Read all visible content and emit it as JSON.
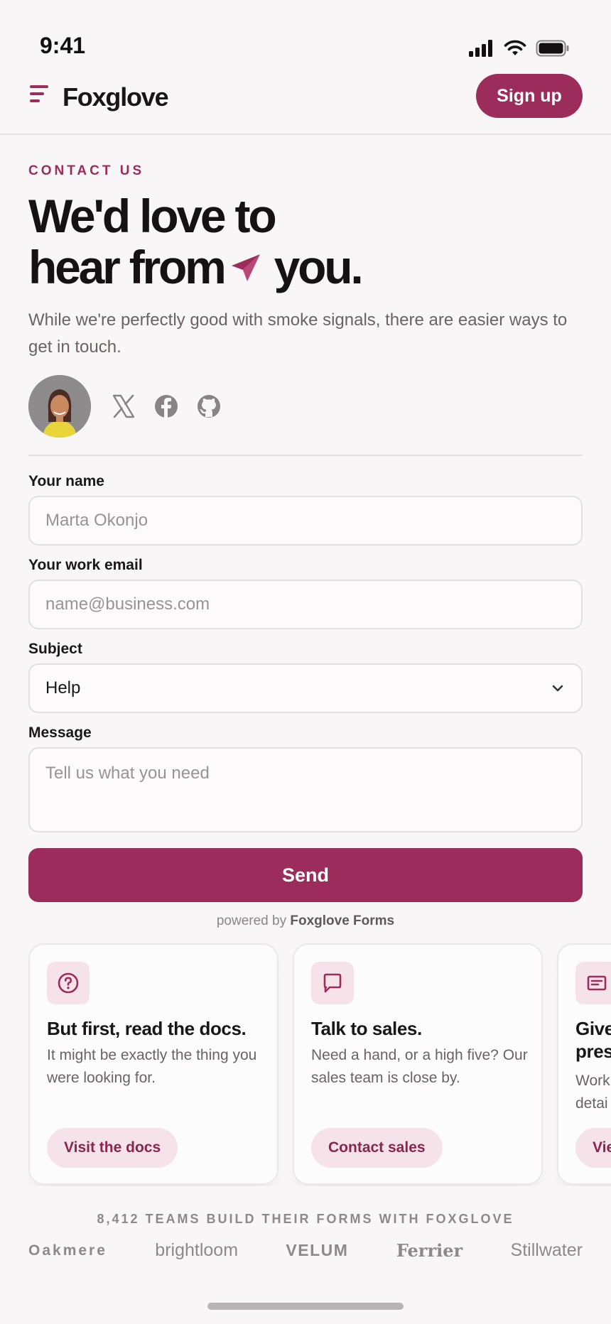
{
  "status_bar": {
    "time": "9:41"
  },
  "header": {
    "logo": "Foxglove",
    "signup_label": "Sign up"
  },
  "hero": {
    "eyebrow": "CONTACT US",
    "headline_line1": "We'd love to",
    "headline_line2_a": "hear from",
    "headline_line2_b": "you.",
    "subtitle": "While we're perfectly good with smoke signals, there are easier ways to get in touch."
  },
  "social": {
    "icons": [
      "x-icon",
      "facebook-icon",
      "github-icon"
    ]
  },
  "form": {
    "name_label": "Your name",
    "name_placeholder": "Marta Okonjo",
    "email_label": "Your work email",
    "email_placeholder": "name@business.com",
    "subject_label": "Subject",
    "subject_value": "Help",
    "message_label": "Message",
    "message_placeholder": "Tell us what you need",
    "send_label": "Send",
    "powered_prefix": "powered by",
    "powered_brand": "Foxglove Forms"
  },
  "cards": [
    {
      "icon": "help-circle-icon",
      "title": "But first, read the docs.",
      "text": "It might be exactly the thing you were looking for.",
      "button": "Visit the docs"
    },
    {
      "icon": "chat-icon",
      "title": "Talk to sales.",
      "text": "Need a hand, or a high five? Our sales team is close by.",
      "button": "Contact sales"
    },
    {
      "icon": "card-icon",
      "title": "Give pres",
      "text": "Work detai",
      "button": "Vie"
    }
  ],
  "social_proof": {
    "headline": "8,412 TEAMS BUILD THEIR FORMS WITH FOXGLOVE",
    "brands": [
      "Oakmere",
      "brightloom",
      "VELUM",
      "Ferrier",
      "Stillwater"
    ]
  },
  "colors": {
    "brand": "#9c2c5b",
    "brand_soft": "#f6e3e9",
    "background": "#f8f6f6"
  }
}
